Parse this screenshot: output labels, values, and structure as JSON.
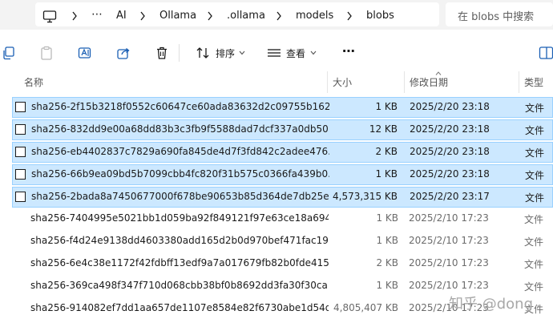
{
  "breadcrumb": {
    "items": [
      "AI",
      "Ollama",
      ".ollama",
      "models",
      "blobs"
    ],
    "overflow": "⋯"
  },
  "search": {
    "placeholder": "在 blobs 中搜索"
  },
  "toolbar": {
    "sort_label": "排序",
    "view_label": "查看",
    "more_label": "⋯"
  },
  "columns": {
    "name": "名称",
    "size": "大小",
    "modified": "修改日期",
    "type": "类型"
  },
  "files": [
    {
      "name": "sha256-2f15b3218f0552c60647ce60ada83632d2c09755b162...",
      "size": "1 KB",
      "modified": "2025/2/20 23:18",
      "type": "文件",
      "selected": true
    },
    {
      "name": "sha256-832dd9e00a68dd83b3c3fb9f5588dad7dcf337a0db50...",
      "size": "12 KB",
      "modified": "2025/2/20 23:18",
      "type": "文件",
      "selected": true
    },
    {
      "name": "sha256-eb4402837c7829a690fa845de4d7f3fd842c2adee476...",
      "size": "2 KB",
      "modified": "2025/2/20 23:18",
      "type": "文件",
      "selected": true
    },
    {
      "name": "sha256-66b9ea09bd5b7099cbb4fc820f31b575c0366fa439b0...",
      "size": "1 KB",
      "modified": "2025/2/20 23:18",
      "type": "文件",
      "selected": true
    },
    {
      "name": "sha256-2bada8a7450677000f678be90653b85d364de7db25e...",
      "size": "4,573,315 KB",
      "modified": "2025/2/20 23:17",
      "type": "文件",
      "selected": true
    },
    {
      "name": "sha256-7404995e5021bb1d059ba92f849121f97e63ce18a694...",
      "size": "1 KB",
      "modified": "2025/2/10 17:23",
      "type": "文件",
      "selected": false
    },
    {
      "name": "sha256-f4d24e9138dd4603380add165d2b0d970bef471fac19...",
      "size": "1 KB",
      "modified": "2025/2/10 17:23",
      "type": "文件",
      "selected": false
    },
    {
      "name": "sha256-6e4c38e1172f42fdbff13edf9a7a017679fb82b0fde415...",
      "size": "2 KB",
      "modified": "2025/2/10 17:23",
      "type": "文件",
      "selected": false
    },
    {
      "name": "sha256-369ca498f347f710d068cbb38bf0b8692dd3fa30f30ca...",
      "size": "1 KB",
      "modified": "2025/2/10 17:23",
      "type": "文件",
      "selected": false
    },
    {
      "name": "sha256-914082ef7dd1aa657de1107e8584e82f6730abe1d54d...",
      "size": "4,805,407 KB",
      "modified": "2025/2/10 17:23",
      "type": "文件",
      "selected": false
    }
  ],
  "watermark": {
    "text": "知乎 @dong"
  },
  "colors": {
    "selection_fill": "#cce8ff",
    "selection_border": "#99d1ff",
    "toolbar_bg": "#f3f3f3"
  }
}
